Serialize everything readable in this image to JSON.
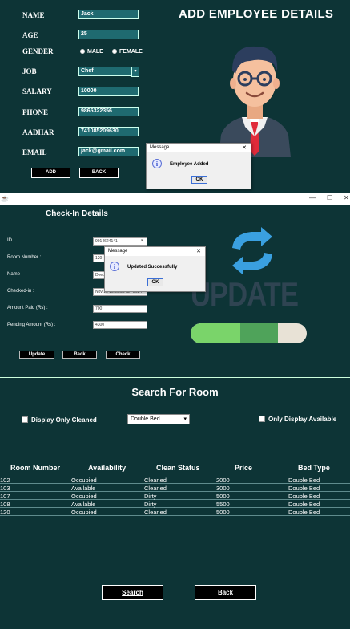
{
  "employee": {
    "title": "ADD EMPLOYEE DETAILS",
    "labels": {
      "name": "NAME",
      "age": "AGE",
      "gender": "GENDER",
      "job": "JOB",
      "salary": "SALARY",
      "phone": "PHONE",
      "aadhar": "AADHAR",
      "email": "EMAIL"
    },
    "values": {
      "name": "Jack",
      "age": "25",
      "job": "Chef",
      "salary": "10000",
      "phone": "9865322356",
      "aadhar": "741085209630",
      "email": "jack@gmail.com"
    },
    "gender_options": [
      "MALE",
      "FEMALE"
    ],
    "add_button": "ADD",
    "back_button": "BACK",
    "dialog": {
      "title": "Message",
      "message": "Employee Added",
      "ok": "OK",
      "close": "✕"
    }
  },
  "checkin": {
    "window_controls": {
      "minimize": "—",
      "maximize": "☐",
      "close": "✕"
    },
    "title": "Check-In Details",
    "labels": {
      "id": "ID :",
      "room": "Room Number :",
      "name": "Name :",
      "checkin": "Checked-in :",
      "paid": "Amount Paid (Rs) :",
      "pending": "Pending Amount (Rs) :"
    },
    "values": {
      "id": "9014624141",
      "room": "120",
      "name": "Deep",
      "checkin": "Nov 15 15:30:38 IST 2024",
      "paid": "700",
      "pending": "4300"
    },
    "update_button": "Update",
    "back_button": "Back",
    "check_button": "Check",
    "image_text": "UPDATE",
    "progress": 0.75,
    "dialog": {
      "title": "Message",
      "message": "Updated Successfully",
      "ok": "OK",
      "close": "✕"
    }
  },
  "search": {
    "title": "Search For Room",
    "only_cleaned_label": "Display Only Cleaned",
    "bed_type_selected": "Double Bed",
    "only_available_label": "Only Display Available",
    "columns": [
      "Room Number",
      "Availability",
      "Clean Status",
      "Price",
      "Bed Type"
    ],
    "rows": [
      [
        "102",
        "Occupied",
        "Cleaned",
        "2000",
        "Double Bed"
      ],
      [
        "103",
        "Available",
        "Cleaned",
        "3000",
        "Double Bed"
      ],
      [
        "107",
        "Occupied",
        "Dirty",
        "5000",
        "Double Bed"
      ],
      [
        "108",
        "Available",
        "Dirty",
        "5500",
        "Double Bed"
      ],
      [
        "120",
        "Occupied",
        "Cleaned",
        "5000",
        "Double Bed"
      ]
    ],
    "search_button": "Search",
    "back_button": "Back"
  },
  "colors": {
    "background": "#0d3436",
    "field_teal": "#1f6a70",
    "progress_fill": "#7ad46a",
    "update_blue": "#3aa0e0"
  }
}
